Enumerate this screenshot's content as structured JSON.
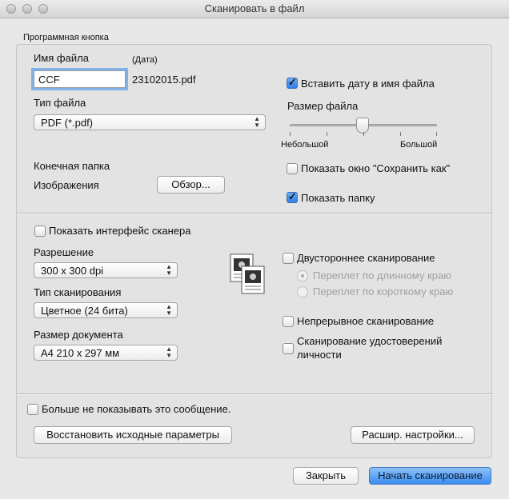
{
  "window": {
    "title": "Сканировать в файл"
  },
  "group_label": "Программная кнопка",
  "file": {
    "name_label": "Имя файла",
    "date_label": "(Дата)",
    "name_value": "CCF",
    "date_value": "23102015.pdf",
    "type_label": "Тип файла",
    "type_value": "PDF (*.pdf)",
    "insert_date_label": "Вставить дату в имя файла",
    "insert_date_checked": true,
    "size_label": "Размер файла",
    "size_min_label": "Небольшой",
    "size_max_label": "Большой",
    "size_level": 0.5,
    "destination_label": "Конечная папка",
    "folder_name": "Изображения",
    "browse_label": "Обзор...",
    "show_save_as_label": "Показать окно \"Сохранить как\"",
    "show_save_as_checked": false,
    "show_folder_label": "Показать папку",
    "show_folder_checked": true
  },
  "scan": {
    "show_interface_label": "Показать интерфейс сканера",
    "resolution_label": "Разрешение",
    "resolution_value": "300 x 300  dpi",
    "scan_type_label": "Тип сканирования",
    "scan_type_value": "Цветное (24 бита)",
    "doc_size_label": "Размер документа",
    "doc_size_value": "A4 210 x 297 мм",
    "duplex_label": "Двустороннее сканирование",
    "long_edge_label": "Переплет по длинному краю",
    "short_edge_label": "Переплет по короткому краю",
    "continuous_label": "Непрерывное сканирование",
    "id_card_label_1": "Сканирование удостоверений",
    "id_card_label_2": "личности"
  },
  "footer": {
    "dont_show_label": "Больше не показывать это сообщение.",
    "restore_label": "Восстановить исходные параметры",
    "advanced_label": "Расшир. настройки...",
    "close_label": "Закрыть",
    "start_label": "Начать сканирование"
  },
  "icons": {
    "duplex": "duplex-pages-icon",
    "checkmark": "checkmark-icon",
    "popup_arrows": "popup-arrows-icon"
  }
}
